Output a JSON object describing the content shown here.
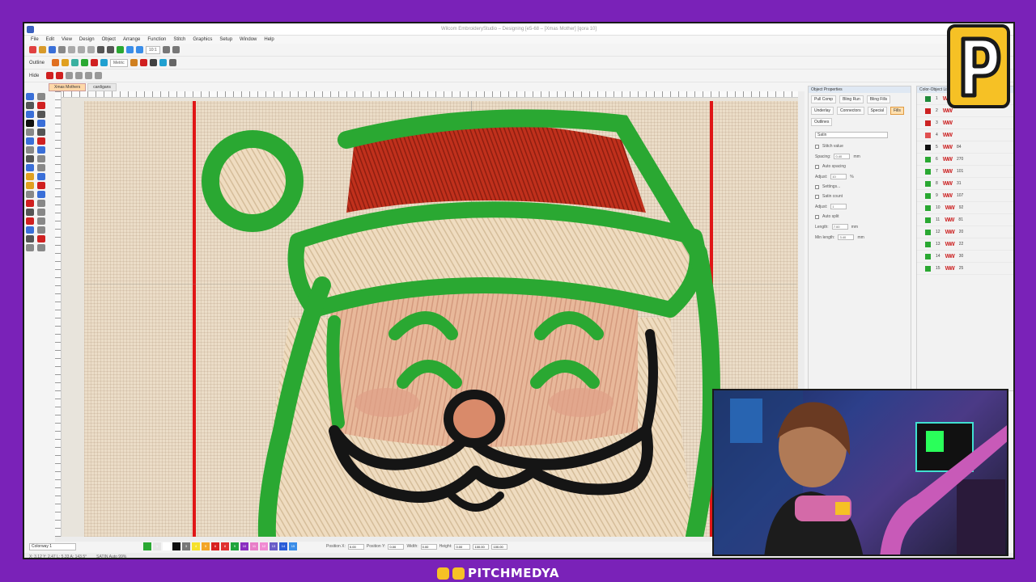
{
  "window": {
    "title": "Wilcom EmbroideryStudio – Designing [e5-68 – [Xmas Mother]      [qora 10]"
  },
  "menu": [
    "File",
    "Edit",
    "View",
    "Design",
    "Object",
    "Arrange",
    "Function",
    "Stitch",
    "Graphics",
    "Setup",
    "Window",
    "Help"
  ],
  "toolbar": {
    "outline_label": "Outline",
    "zoom_value": "10:1",
    "units_label": "Metric",
    "hide_label": "Hide"
  },
  "doc_tabs": [
    "Xmas Mothers",
    "cardigans"
  ],
  "object_properties": {
    "title": "Object Properties",
    "tabs": [
      "Pull Comp",
      "Bling Run",
      "Bling Fills",
      "Underlay",
      "Connectors",
      "Special",
      "Fills",
      "Outlines"
    ],
    "active_tab": "Fills",
    "stitch_type": "Satin",
    "fields": [
      {
        "label": "Stitch value",
        "value": ""
      },
      {
        "label": "Spacing:",
        "value": "0.40",
        "unit": "mm"
      },
      {
        "label": "Auto spacing",
        "value": ""
      },
      {
        "label": "Adjust:",
        "value": "10",
        "unit": "%"
      },
      {
        "label": "Settings...",
        "value": ""
      },
      {
        "label": "Satin count",
        "value": ""
      },
      {
        "label": "Adjust:",
        "value": "1",
        "unit": ""
      },
      {
        "label": "Auto split",
        "value": ""
      },
      {
        "label": "Length:",
        "value": "7.00",
        "unit": "mm"
      },
      {
        "label": "Min length:",
        "value": "3.40",
        "unit": "mm"
      }
    ]
  },
  "color_object_list": {
    "title": "Color-Object List",
    "rows": [
      {
        "index": "1",
        "color": "#1f8a3a",
        "count": ""
      },
      {
        "index": "2",
        "color": "#cc2222",
        "count": ""
      },
      {
        "index": "3",
        "color": "#cc2222",
        "count": ""
      },
      {
        "index": "4",
        "color": "#e05050",
        "count": ""
      },
      {
        "index": "5",
        "color": "#111111",
        "count": "84"
      },
      {
        "index": "6",
        "color": "#2aa832",
        "count": "270"
      },
      {
        "index": "7",
        "color": "#2aa832",
        "count": "101"
      },
      {
        "index": "8",
        "color": "#2aa832",
        "count": "31"
      },
      {
        "index": "9",
        "color": "#2aa832",
        "count": "107"
      },
      {
        "index": "10",
        "color": "#2aa832",
        "count": "92"
      },
      {
        "index": "11",
        "color": "#2aa832",
        "count": "81"
      },
      {
        "index": "12",
        "color": "#2aa832",
        "count": "20"
      },
      {
        "index": "13",
        "color": "#2aa832",
        "count": "22"
      },
      {
        "index": "14",
        "color": "#2aa832",
        "count": "30"
      },
      {
        "index": "15",
        "color": "#2aa832",
        "count": "25"
      }
    ]
  },
  "bottom_bar": {
    "colorway": "Colorway 1",
    "palette": [
      {
        "n": "",
        "color": "#2aa832"
      },
      {
        "n": "1",
        "color": "#e6e6e6"
      },
      {
        "n": "2",
        "color": "#ffffff"
      },
      {
        "n": "",
        "color": "#111111"
      },
      {
        "n": "3",
        "color": "#777777"
      },
      {
        "n": "4",
        "color": "#f6e12b"
      },
      {
        "n": "5",
        "color": "#f3a526"
      },
      {
        "n": "6",
        "color": "#d82020"
      },
      {
        "n": "8",
        "color": "#e03030"
      },
      {
        "n": "9",
        "color": "#1fa43b"
      },
      {
        "n": "10",
        "color": "#8a2ec0"
      },
      {
        "n": "11",
        "color": "#e87ec8"
      },
      {
        "n": "12",
        "color": "#f08ad2"
      },
      {
        "n": "13",
        "color": "#6a5cc8"
      },
      {
        "n": "14",
        "color": "#2a5dd8"
      },
      {
        "n": "15",
        "color": "#3a8de8"
      }
    ],
    "position_x_label": "Position X:",
    "position_x": "0.00",
    "position_y_label": "Position Y:",
    "position_y": "0.00",
    "width_label": "Width:",
    "width": "0.00",
    "height_label": "Height:",
    "height": "0.00",
    "scale_x": "100.00",
    "scale_y": "100.00",
    "zoom_small": "1.00"
  },
  "status": {
    "left": "X: 3.12   Y: 2.47   L: 5.33   A: 143.5°",
    "mid": "SATIN Auto 99%"
  },
  "footer": {
    "brand": "PITCHMEDYA"
  },
  "colors": {
    "frame": "#7a22b8",
    "logo": "#f6c125",
    "hoop": "#e01616",
    "satin_green": "#2aa832"
  }
}
